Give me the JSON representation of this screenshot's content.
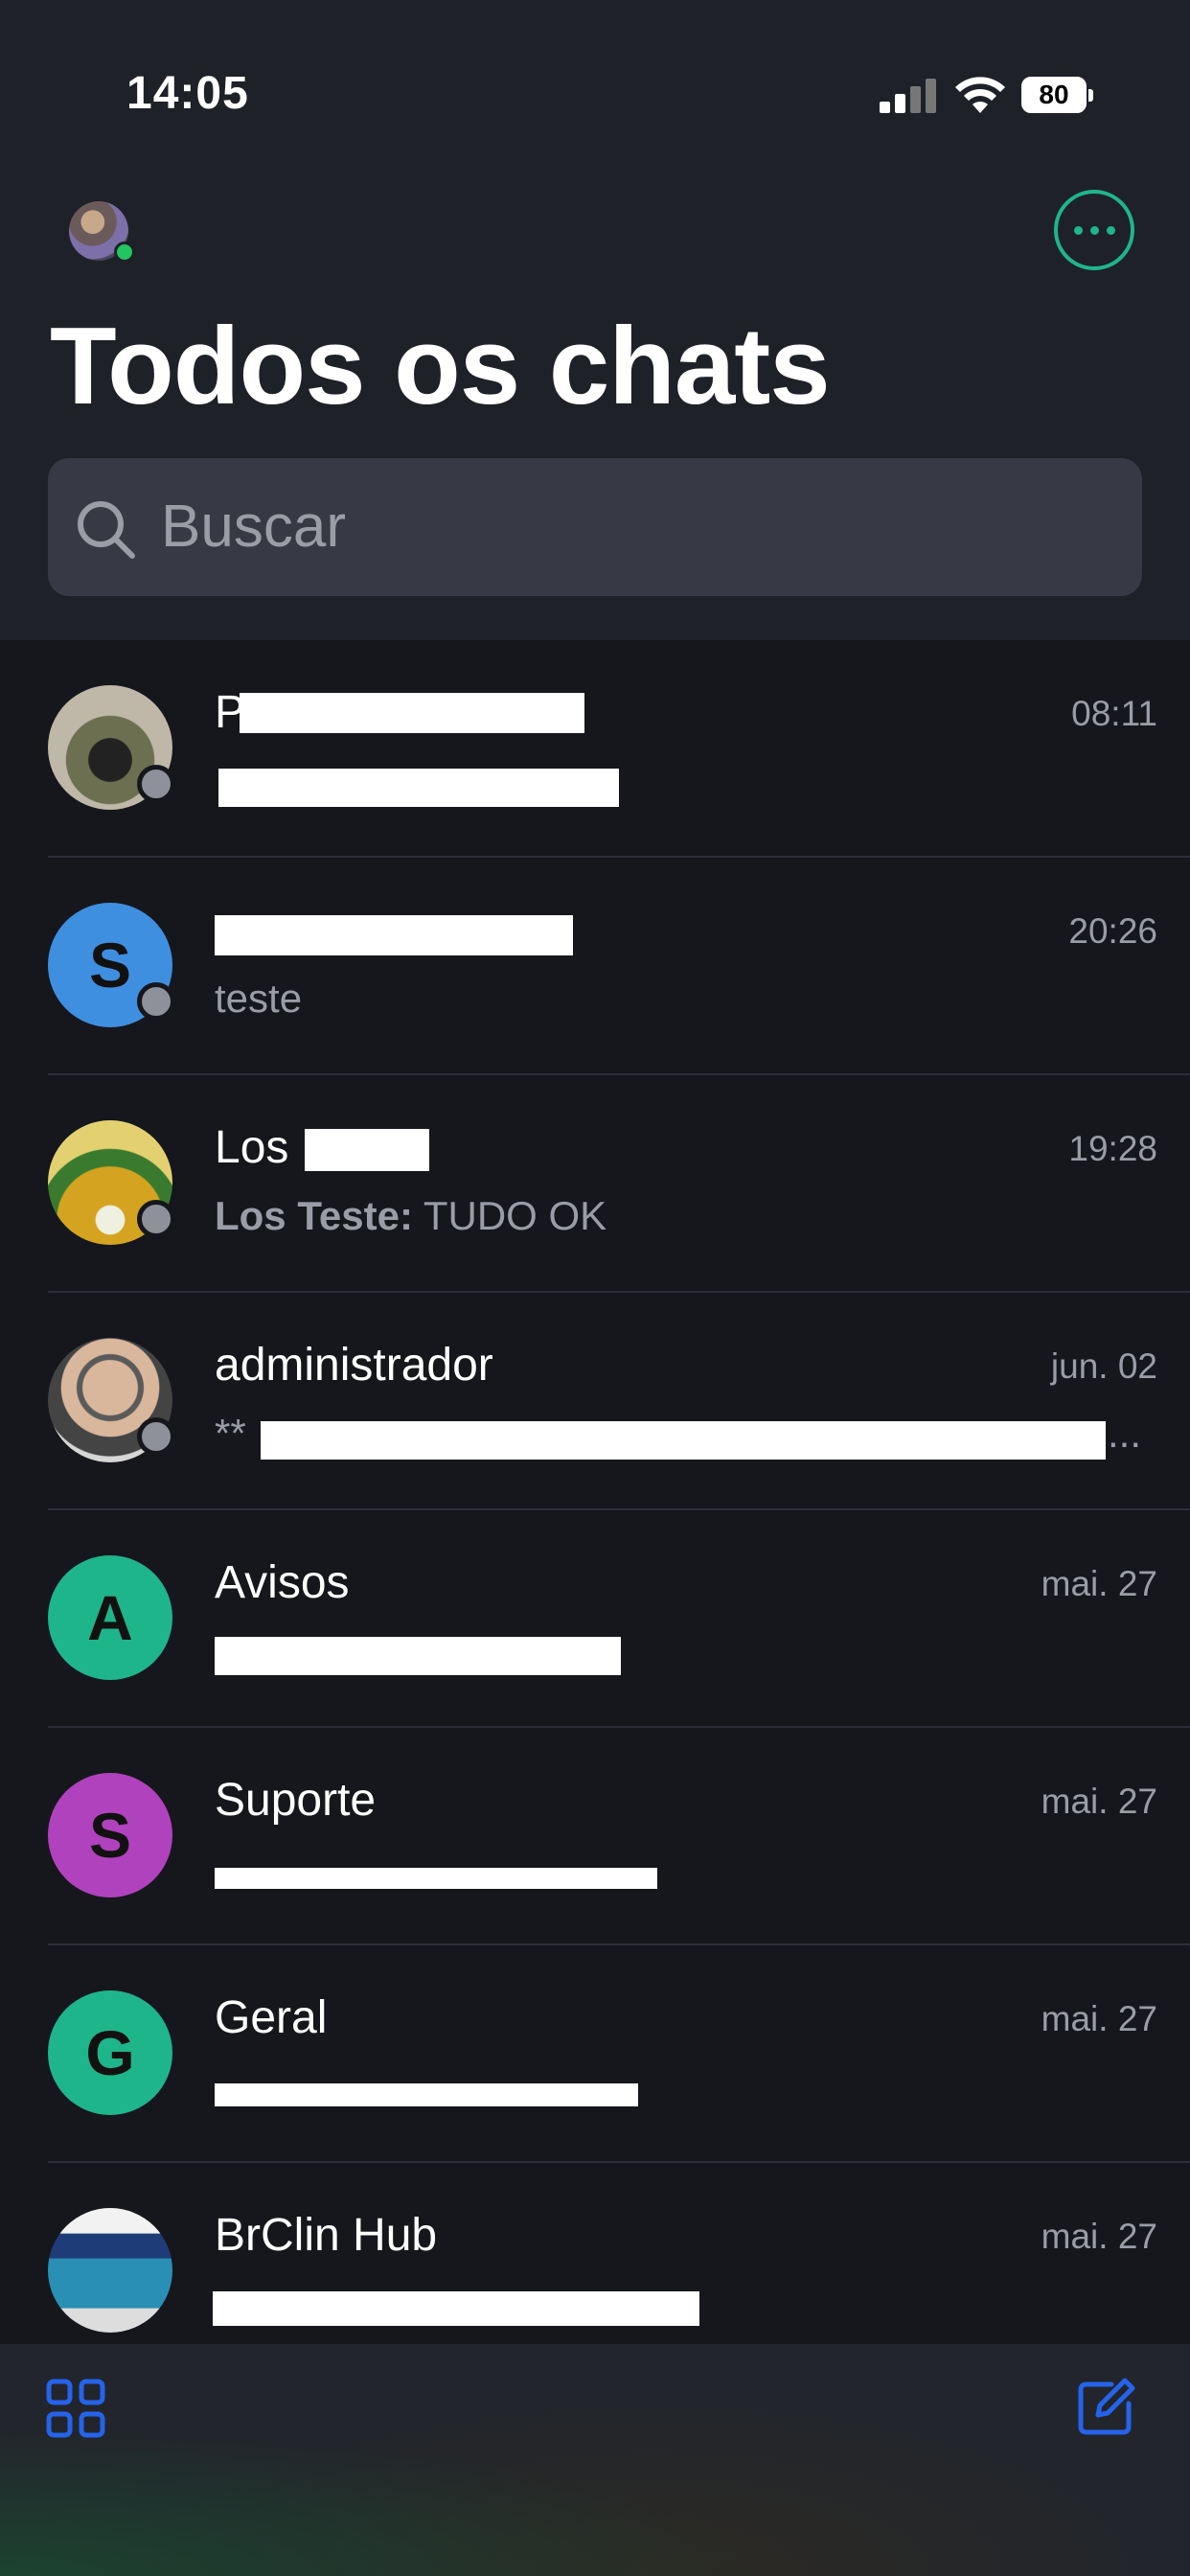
{
  "status_bar": {
    "time": "14:05",
    "battery": "80"
  },
  "header": {
    "title": "Todos os chats",
    "more_icon": "ellipsis-circle-icon",
    "accent_color": "#1fb58a"
  },
  "search": {
    "placeholder": "Buscar"
  },
  "chats": [
    {
      "name": "P",
      "preview": "",
      "time": "08:11",
      "avatar_letter": "",
      "avatar_color": "#4a5246"
    },
    {
      "name": "",
      "preview": "teste",
      "time": "20:26",
      "avatar_letter": "S",
      "avatar_color": "#3f8fe0"
    },
    {
      "name": "Los",
      "preview_sender": "Los Teste:",
      "preview": "TUDO OK",
      "time": "19:28",
      "avatar_letter": "",
      "avatar_color": "#e6b820"
    },
    {
      "name": "administrador",
      "preview": "**",
      "preview_end": "...",
      "time": "jun. 02",
      "avatar_letter": "",
      "avatar_color": "#c9c9c9"
    },
    {
      "name": "Avisos",
      "preview": "",
      "time": "mai. 27",
      "avatar_letter": "A",
      "avatar_color": "#1fb58a"
    },
    {
      "name": "Suporte",
      "preview": "",
      "time": "mai. 27",
      "avatar_letter": "S",
      "avatar_color": "#b042bd"
    },
    {
      "name": "Geral",
      "preview": "",
      "time": "mai. 27",
      "avatar_letter": "G",
      "avatar_color": "#1fb58a"
    },
    {
      "name": "BrClin Hub",
      "preview": "",
      "time": "mai. 27",
      "avatar_letter": "",
      "avatar_color": "#e9ecef"
    }
  ],
  "tabbar": {
    "left_icon": "grid-icon",
    "right_icon": "compose-icon",
    "icon_color": "#2563eb"
  }
}
